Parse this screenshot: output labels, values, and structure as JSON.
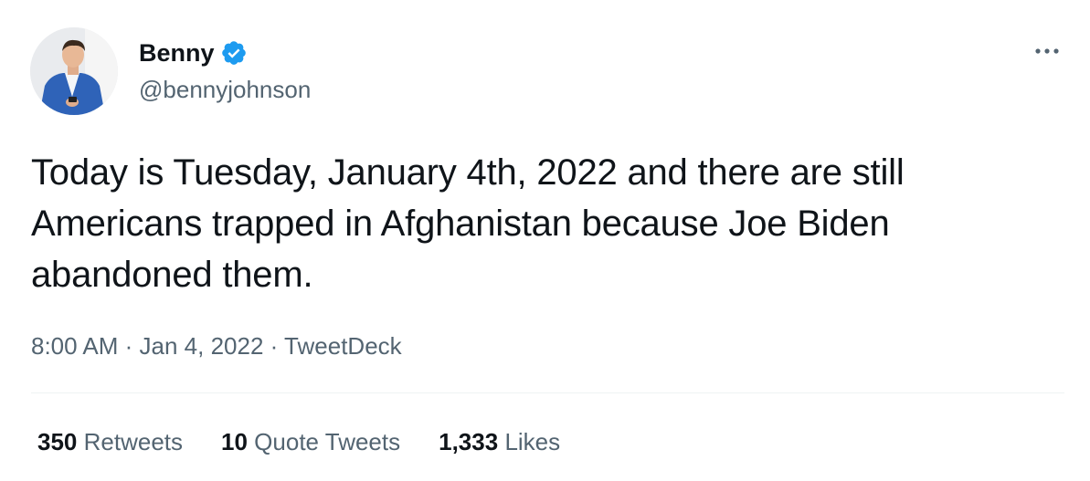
{
  "tweet": {
    "author": {
      "display_name": "Benny",
      "handle": "@bennyjohnson",
      "verified": true,
      "avatar_icon": "profile-photo"
    },
    "text": "Today is Tuesday, January 4th, 2022 and there are still Americans trapped in Afghanistan because Joe Biden abandoned them.",
    "meta": {
      "time": "8:00 AM",
      "separator": " · ",
      "date": "Jan 4, 2022",
      "source": "TweetDeck"
    },
    "stats": {
      "retweets": {
        "count": "350",
        "label": "Retweets"
      },
      "quote_tweets": {
        "count": "10",
        "label": "Quote Tweets"
      },
      "likes": {
        "count": "1,333",
        "label": "Likes"
      }
    }
  },
  "colors": {
    "verified_blue": "#1d9bf0",
    "text_primary": "#0f1419",
    "text_secondary": "#536471",
    "divider": "#eff3f4"
  }
}
